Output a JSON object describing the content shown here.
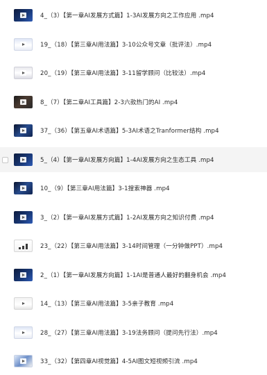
{
  "files": [
    {
      "name": "4_（3）【第一章AI发展方式篇】1-3AI发展方向之工作应用 .mp4",
      "thumb": "dark"
    },
    {
      "name": "19_（18）【第三章AI用法篇】3-10公众号文章（批评法）.mp4",
      "thumb": "slide"
    },
    {
      "name": "20_（19）【第三章AI用法篇】3-11留学顾问（比较法）.mp4",
      "thumb": "slide2"
    },
    {
      "name": "8_（7）【第二章AI工具篇】2-3六款热门的AI .mp4",
      "thumb": "person"
    },
    {
      "name": "37_（36）【第五章AI术语篇】5-3AI术语之Tranformer结构 .mp4",
      "thumb": "grid"
    },
    {
      "name": "5_（4）【第一章AI发展方向篇】1-4AI发展方向之生态工具 .mp4",
      "thumb": "dark"
    },
    {
      "name": "10_（9）【第三章AI用法篇】3-1搜索神器 .mp4",
      "thumb": "grid"
    },
    {
      "name": "3_（2）【第一章AI发展方式篇】1-2AI发展方向之知识付费 .mp4",
      "thumb": "dark"
    },
    {
      "name": "23_（22）【第三章AI用法篇】3-14时间管理（一分钟做PPT）.mp4",
      "thumb": "chart"
    },
    {
      "name": "2_（1）【第一章AI发展方向篇】1-1AI是普通人最好的翻身机会 .mp4",
      "thumb": "dark"
    },
    {
      "name": "14_（13）【第三章AI用法篇】3-5亲子教育 .mp4",
      "thumb": "light"
    },
    {
      "name": "28_（27）【第三章AI用法篇】3-19法务顾问（提问先行法）.mp4",
      "thumb": "slide"
    },
    {
      "name": "33_（32）【第四章AI视觉篇】4-5AI图文短视频引流 .mp4",
      "thumb": "mix"
    }
  ],
  "selected_index": 5,
  "colors": {
    "row_highlight": "#f4f4f4",
    "text": "#2a2a2a"
  }
}
